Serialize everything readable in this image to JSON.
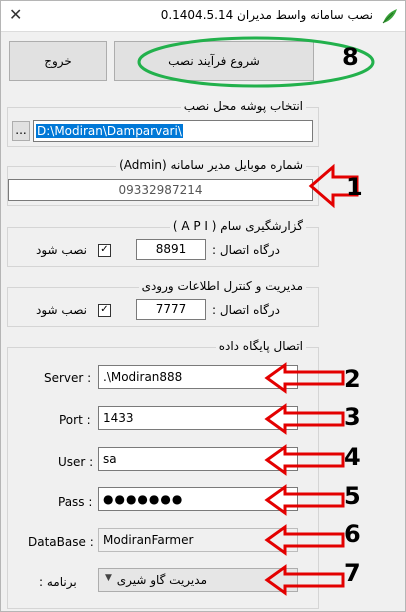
{
  "window": {
    "title": "نصب سامانه واسط مدیران 0.1404.5.14"
  },
  "buttons": {
    "exit": "خروج",
    "start_install": "شروع فرآیند نصب"
  },
  "install_path": {
    "group_title": "انتخاب پوشه محل نصب",
    "value": "D:\\Modiran\\Damparvari\\",
    "browse": "..."
  },
  "admin": {
    "group_title": "شماره موبایل مدیر سامانه (Admin)",
    "value": "09332987214"
  },
  "api": {
    "group_title": "گزارشگیری سام ( A P I )",
    "port_label": "درگاه اتصال :",
    "port_value": "8891",
    "install_label": "نصب شود"
  },
  "access": {
    "group_title": "مدیریت و کنترل اطلاعات ورودی",
    "port_label": "درگاه اتصال :",
    "port_value": "7777",
    "install_label": "نصب شود"
  },
  "db": {
    "group_title": "اتصال پایگاه داده",
    "server_label": "Server :",
    "server_value": ".\\Modiran888",
    "port_label": "Port :",
    "port_value": "1433",
    "user_label": "User :",
    "user_value": "sa",
    "pass_label": "Pass :",
    "pass_value": "●●●●●●●",
    "database_label": "DataBase :",
    "database_value": "ModiranFarmer",
    "program_label": "برنامه :",
    "program_value": "مدیریت گاو شیری"
  },
  "annotations": [
    "1",
    "2",
    "3",
    "4",
    "5",
    "6",
    "7",
    "8"
  ],
  "colors": {
    "arrow_red": "#e30000",
    "ellipse_green": "#22b14c",
    "selection_blue": "#0078d7"
  }
}
